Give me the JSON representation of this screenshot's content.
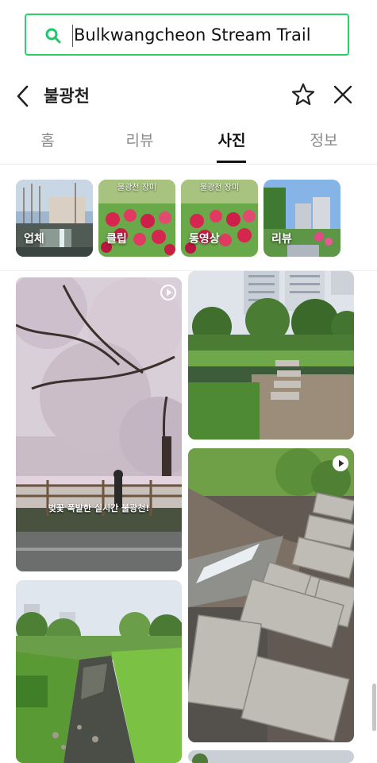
{
  "search": {
    "query": "Bulkwangcheon Stream Trail"
  },
  "header": {
    "title": "불광천"
  },
  "tabs": [
    {
      "label": "홈"
    },
    {
      "label": "리뷰"
    },
    {
      "label": "사진"
    },
    {
      "label": "정보"
    }
  ],
  "active_tab": "사진",
  "filters": [
    {
      "label": "업체",
      "overlay_text": ""
    },
    {
      "label": "클립",
      "overlay_text": "불광천 장미"
    },
    {
      "label": "동영상",
      "overlay_text": "불광천 장미"
    },
    {
      "label": "리뷰",
      "overlay_text": ""
    }
  ],
  "photos": [
    {
      "caption": "벚꽃 폭발한 실시간 불광천!",
      "icon": "play-circle-icon"
    },
    {
      "caption": "",
      "icon": ""
    },
    {
      "caption": "",
      "icon": "play-filled-icon"
    },
    {
      "caption": "",
      "icon": ""
    }
  ],
  "colors": {
    "accent": "#2bd06b",
    "active_tab": "#111111",
    "inactive_tab": "#8a8a8a"
  }
}
